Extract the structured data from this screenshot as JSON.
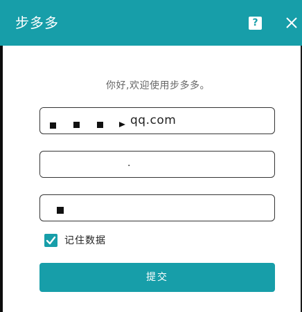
{
  "window": {
    "title": "步多多",
    "help_label": "?",
    "close_icon": "close-icon"
  },
  "form": {
    "greeting": "你好,欢迎使用步多多。",
    "email_value": "qq.com",
    "password_value": ".",
    "remember_label": "记住数据",
    "remember_checked": true,
    "submit_label": "提交"
  },
  "colors": {
    "accent": "#179ea9",
    "text": "#222222",
    "muted": "#666666",
    "border": "#333333"
  }
}
